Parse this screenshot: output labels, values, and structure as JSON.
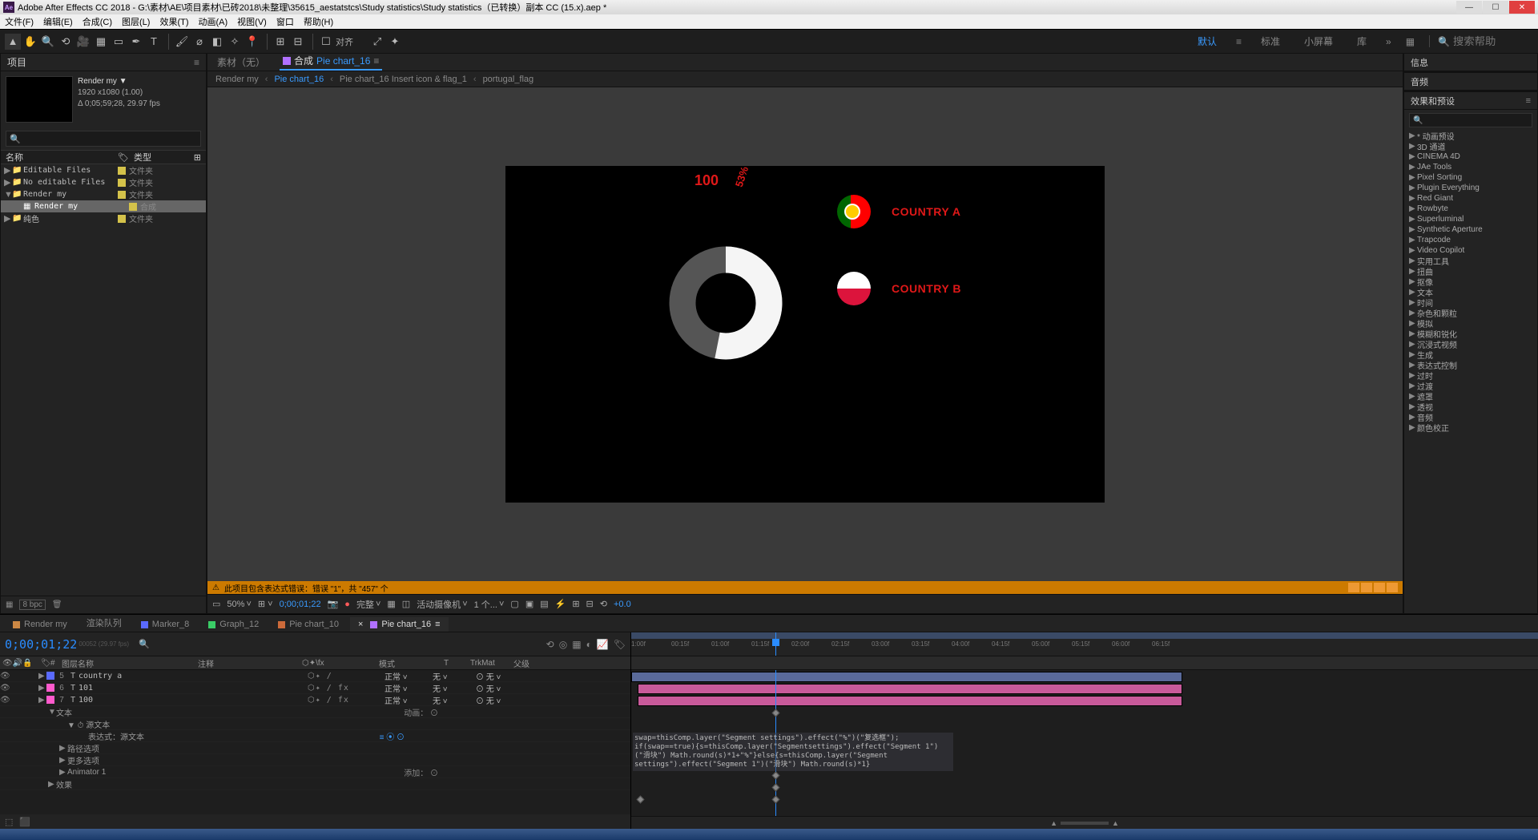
{
  "title": "Adobe After Effects CC 2018 - G:\\素材\\AE\\项目素材\\已砖2018\\未整理\\35615_aestatstcs\\Study statistics\\Study statistics（已转换）副本 CC (15.x).aep *",
  "menu": [
    "文件(F)",
    "编辑(E)",
    "合成(C)",
    "图层(L)",
    "效果(T)",
    "动画(A)",
    "视图(V)",
    "窗口",
    "帮助(H)"
  ],
  "toolbar_align": "对齐",
  "workspaces": {
    "default": "默认",
    "standard": "标准",
    "small": "小屏幕",
    "lib": "库"
  },
  "search_help_ph": "搜索帮助",
  "project": {
    "title": "项目",
    "meta_name": "Render my ▼",
    "meta_dim": "1920 x1080 (1.00)",
    "meta_dur": "Δ 0;05;59;28, 29.97 fps",
    "col_name": "名称",
    "col_type": "类型",
    "rows": [
      {
        "tw": "▶",
        "ic": "📁",
        "nm": "Editable Files",
        "ty": "文件夹",
        "sel": false
      },
      {
        "tw": "▶",
        "ic": "📁",
        "nm": "No editable Files",
        "ty": "文件夹",
        "sel": false
      },
      {
        "tw": "▼",
        "ic": "📁",
        "nm": "Render my",
        "ty": "文件夹",
        "sel": false
      },
      {
        "tw": "",
        "ic": "▦",
        "nm": "Render my",
        "ty": "合成",
        "sel": true
      },
      {
        "tw": "▶",
        "ic": "📁",
        "nm": "纯色",
        "ty": "文件夹",
        "sel": false
      }
    ],
    "foot_bpc": "8 bpc"
  },
  "comp": {
    "tab_footage": "素材（无）",
    "tab_comp_prefix": "合成",
    "tab_comp_name": "Pie chart_16",
    "bc": [
      "Render my",
      "Pie chart_16",
      "Pie chart_16 Insert icon & flag_1",
      "portugal_flag"
    ],
    "bc_active_idx": 1,
    "warn": "此项目包含表达式错误：错误 \"1\"，共 \"457\" 个",
    "foot": {
      "zoom": "50%",
      "tc": "0;00;01;22",
      "quality": "完整",
      "cam": "活动摄像机",
      "views": "1 个...",
      "exp": "+0.0"
    }
  },
  "chart_data": {
    "type": "pie",
    "donut": true,
    "title": "",
    "value_label": "100",
    "percent_label": "53%",
    "series": [
      {
        "name": "COUNTRY A",
        "value": 53,
        "color": "#f5f5f5",
        "flag": "portugal"
      },
      {
        "name": "COUNTRY B",
        "value": 47,
        "color": "#555555",
        "flag": "poland"
      }
    ],
    "legend": {
      "a": "COUNTRY A",
      "b": "COUNTRY B"
    },
    "ylim": [
      0,
      100
    ]
  },
  "right": {
    "p1": "信息",
    "p2": "音频",
    "p3": "效果和预设",
    "items": [
      "* 动画预设",
      "3D 通道",
      "CINEMA 4D",
      "JAe Tools",
      "Pixel Sorting",
      "Plugin Everything",
      "Red Giant",
      "Rowbyte",
      "Superluminal",
      "Synthetic Aperture",
      "Trapcode",
      "Video Copilot",
      "实用工具",
      "扭曲",
      "抠像",
      "文本",
      "时间",
      "杂色和颗粒",
      "模拟",
      "模糊和锐化",
      "沉浸式视频",
      "生成",
      "表达式控制",
      "过时",
      "过渡",
      "遮罩",
      "透视",
      "音频",
      "颜色校正"
    ]
  },
  "timeline": {
    "tabs": [
      {
        "c": "#cc8844",
        "l": "Render my"
      },
      {
        "c": "",
        "l": "渲染队列"
      },
      {
        "c": "#5a6aff",
        "l": "Marker_8"
      },
      {
        "c": "#3acc66",
        "l": "Graph_12"
      },
      {
        "c": "#cc6a3a",
        "l": "Pie chart_10"
      },
      {
        "c": "#b070ff",
        "l": "Pie chart_16"
      }
    ],
    "active_tab": 5,
    "tc": "0;00;01;22",
    "tc_sub": "00052 (29.97 fps)",
    "cols": {
      "src": "图层名称",
      "comment": "注释",
      "switches": "⬡✦\\fx",
      "mode": "模式",
      "trk": "TrkMat",
      "parent": "父级"
    },
    "ruler": [
      "1:00f",
      "00:15f",
      "01:00f",
      "01:15f",
      "02:00f",
      "02:15f",
      "03:00f",
      "03:15f",
      "04:00f",
      "04:15f",
      "05:00f",
      "05:15f",
      "06:00f",
      "06:15f"
    ],
    "layers": [
      {
        "n": "5",
        "t": "T",
        "name": "country a",
        "c": "#5a6aff",
        "sw": "⬡✦ /",
        "mode": "正常",
        "trk": "无",
        "par": "无"
      },
      {
        "n": "6",
        "t": "T",
        "name": "101",
        "c": "#ff5acc",
        "sw": "⬡✦ / fx",
        "mode": "正常",
        "trk": "无",
        "par": "无"
      },
      {
        "n": "7",
        "t": "T",
        "name": "100",
        "c": "#ff5acc",
        "sw": "⬡✦ / fx",
        "mode": "正常",
        "trk": "无",
        "par": "无"
      }
    ],
    "sub": [
      "文本",
      "源文本",
      "表达式：源文本",
      "路径选项",
      "更多选项",
      "Animator 1",
      "效果"
    ],
    "anim_label": "动画：",
    "add_label": "添加：",
    "expr": "swap=thisComp.layer(\"Segment settings\").effect(\"%\")(\"复选框\");\nif(swap==true){s=thisComp.layer(\"Segmentsettings\").effect(\"Segment 1\")(\"滑块\")\nMath.round(s)*1+\"%\"}else{s=thisComp.layer(\"Segment settings\").effect(\"Segment 1\")(\"滑块\")\nMath.round(s)*1}"
  }
}
